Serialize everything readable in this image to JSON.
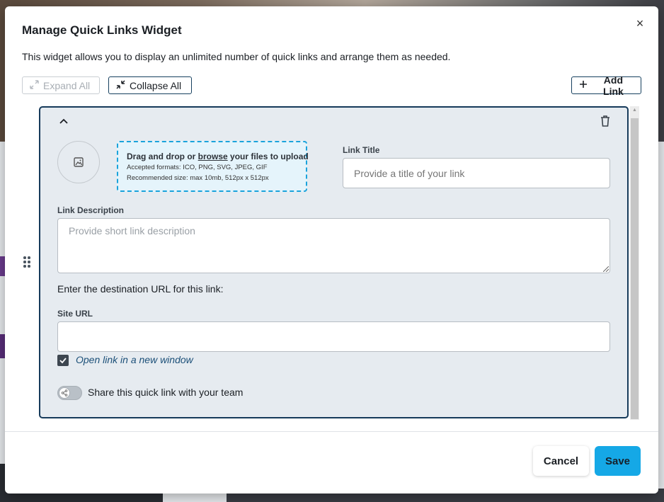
{
  "modal": {
    "title": "Manage Quick Links Widget",
    "description": "This widget allows you to display an unlimited number of quick links and arrange them as needed.",
    "close_icon": "×"
  },
  "toolbar": {
    "expand_all": "Expand All",
    "collapse_all": "Collapse All",
    "add_link": "Add Link"
  },
  "link_card": {
    "upload": {
      "line1_pre": "Drag and drop or ",
      "line1_link": "browse",
      "line1_post": " your files to upload",
      "formats": "Accepted formats: ICO, PNG, SVG, JPEG, GIF",
      "size": "Recommended size: max 10mb, 512px x 512px"
    },
    "link_title_label": "Link Title",
    "link_title_placeholder": "Provide a title of your link",
    "link_description_label": "Link Description",
    "link_description_placeholder": "Provide short link description",
    "destination_prompt": "Enter the destination URL for this link:",
    "site_url_label": "Site URL",
    "site_url_value": "",
    "open_new_window_label": "Open link in a new window",
    "open_new_window_checked": true,
    "share_label": "Share this quick link with your team",
    "share_enabled": false
  },
  "footer": {
    "cancel": "Cancel",
    "save": "Save"
  },
  "colors": {
    "accent": "#15a8e6",
    "card_border": "#163a5a",
    "upload_border": "#1aa3dc"
  }
}
